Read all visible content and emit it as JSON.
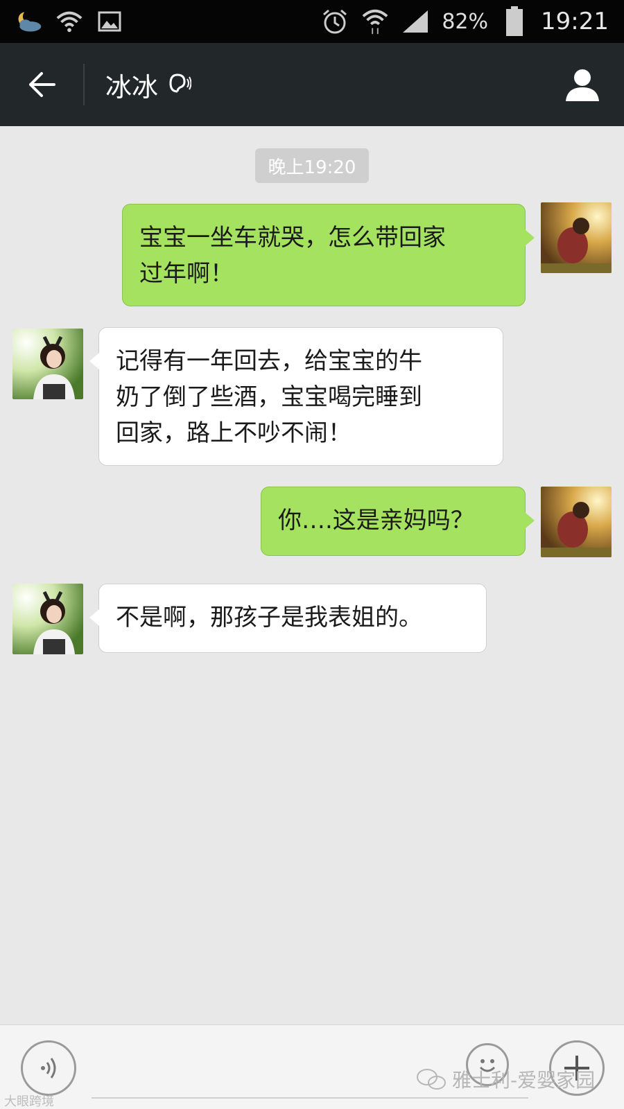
{
  "status_bar": {
    "battery_percent": "82%",
    "time": "19:21",
    "icons": [
      "weather-moon-icon",
      "wifi-alert-icon",
      "image-icon",
      "alarm-icon",
      "wifi-icon",
      "signal-icon",
      "battery-icon"
    ]
  },
  "header": {
    "title": "冰冰",
    "icons": [
      "back-arrow-icon",
      "ear-icon",
      "profile-icon"
    ]
  },
  "chat": {
    "timestamp": "晚上19:20",
    "messages": [
      {
        "side": "out",
        "line1": "宝宝一坐车就哭，怎么带回家",
        "line2": "过年啊！"
      },
      {
        "side": "in",
        "line1": "记得有一年回去，给宝宝的牛",
        "line2": "奶了倒了些酒，宝宝喝完睡到",
        "line3": "回家，路上不吵不闹！"
      },
      {
        "side": "out",
        "line1": "你….这是亲妈吗？"
      },
      {
        "side": "in",
        "line1": "不是啊，那孩子是我表姐的。"
      }
    ]
  },
  "input_bar": {
    "icons": [
      "voice-icon",
      "emoji-icon",
      "plus-icon"
    ],
    "watermark": "雅士利-爱婴家园",
    "watermark_small": "大眼跨境"
  },
  "colors": {
    "out_bubble": "#a5e25f",
    "in_bubble": "#ffffff",
    "header": "#22282a"
  }
}
